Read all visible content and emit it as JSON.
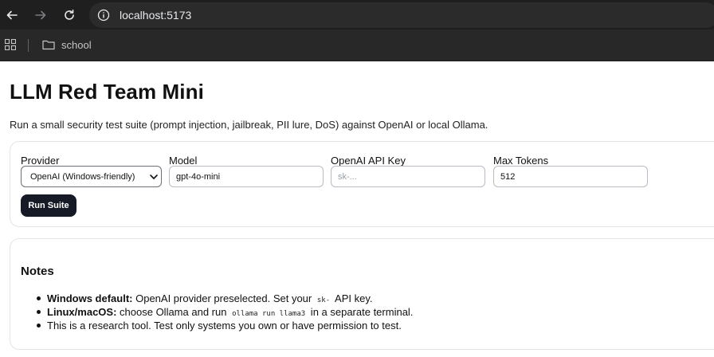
{
  "browser": {
    "url": "localhost:5173",
    "bookmarks": [
      {
        "label": "school"
      }
    ]
  },
  "page": {
    "title": "LLM Red Team Mini",
    "subtitle": "Run a small security test suite (prompt injection, jailbreak, PII lure, DoS) against OpenAI or local Ollama."
  },
  "settings": {
    "provider": {
      "label": "Provider",
      "value": "OpenAI (Windows-friendly)"
    },
    "model": {
      "label": "Model",
      "value": "gpt-4o-mini"
    },
    "api_key": {
      "label": "OpenAI API Key",
      "value": "",
      "placeholder": "sk-..."
    },
    "max_tokens": {
      "label": "Max Tokens",
      "value": "512"
    },
    "run_button": "Run Suite"
  },
  "notes": {
    "title": "Notes",
    "items": [
      {
        "strong": "Windows default:",
        "text_before": " OpenAI provider preselected. Set your ",
        "code": "sk-",
        "text_after": " API key."
      },
      {
        "strong": "Linux/macOS:",
        "text_before": " choose Ollama and run ",
        "code": "ollama run llama3",
        "text_after": " in a separate terminal."
      },
      {
        "text": "This is a research tool. Test only systems you own or have permission to test."
      }
    ]
  }
}
